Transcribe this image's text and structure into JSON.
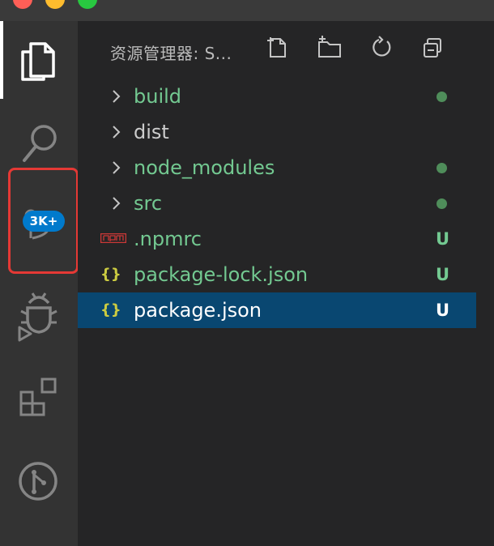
{
  "window": {
    "traffic_lights": [
      "#ff5f57",
      "#febc2e",
      "#28c840"
    ]
  },
  "activity_bar": {
    "items": [
      "explorer-icon",
      "search-icon",
      "source-control-icon",
      "debug-icon",
      "extensions-icon",
      "git-graph-icon"
    ],
    "scm_badge": "3K+"
  },
  "sidebar": {
    "title": "资源管理器: S...",
    "actions": [
      "new-file-icon",
      "new-folder-icon",
      "refresh-icon",
      "collapse-all-icon"
    ],
    "items": [
      {
        "label": "build",
        "type": "folder",
        "color": "#73c991",
        "status": "dot"
      },
      {
        "label": "dist",
        "type": "folder",
        "color": "#cccccc",
        "status": ""
      },
      {
        "label": "node_modules",
        "type": "folder",
        "color": "#73c991",
        "status": "dot"
      },
      {
        "label": "src",
        "type": "folder",
        "color": "#73c991",
        "status": "dot"
      },
      {
        "label": ".npmrc",
        "type": "npm-file",
        "color": "#73c991",
        "status": "U"
      },
      {
        "label": "package-lock.json",
        "type": "json-file",
        "color": "#73c991",
        "status": "U"
      },
      {
        "label": "package.json",
        "type": "json-file",
        "color": "#ffffff",
        "status": "U",
        "selected": true
      }
    ],
    "json_icon_text": "{}",
    "colors": {
      "untracked": "#73c991",
      "selected_bg": "#094771",
      "json_icon": "#cbcb41",
      "npm_icon": "#cb3837"
    }
  }
}
